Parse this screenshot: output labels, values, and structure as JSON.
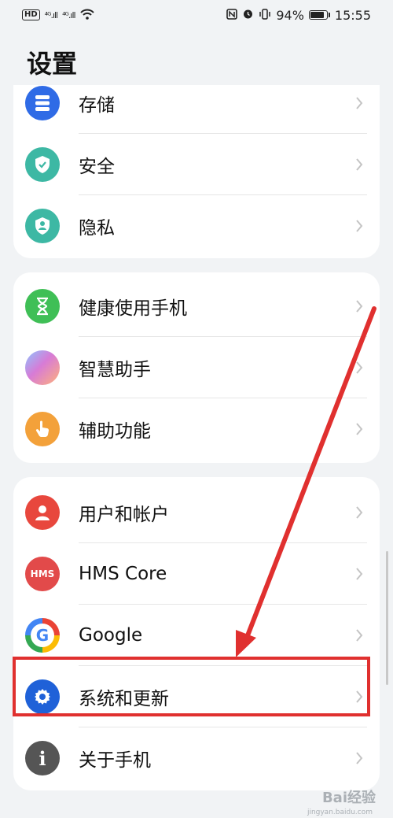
{
  "statusbar": {
    "hd": "HD",
    "net1": "⁴ᴳ.ıll",
    "net2": "⁴ᴳ.ıll",
    "battery_percent": "94%",
    "battery_level": 0.94,
    "time": "15:55"
  },
  "page_title": "设置",
  "groups": [
    {
      "items": [
        {
          "label": "存储",
          "icon": "storage-icon",
          "color": "#2f6be6"
        },
        {
          "label": "安全",
          "icon": "security-shield-icon",
          "color": "#3db8a4"
        },
        {
          "label": "隐私",
          "icon": "privacy-icon",
          "color": "#3db8a4"
        }
      ]
    },
    {
      "items": [
        {
          "label": "健康使用手机",
          "icon": "hourglass-icon",
          "color": "#3fbf56"
        },
        {
          "label": "智慧助手",
          "icon": "assistant-orb-icon",
          "color": "#d77bd6"
        },
        {
          "label": "辅助功能",
          "icon": "hand-pointer-icon",
          "color": "#f3a13a"
        }
      ]
    },
    {
      "items": [
        {
          "label": "用户和帐户",
          "icon": "user-icon",
          "color": "#e8473d"
        },
        {
          "label": "HMS Core",
          "icon": "hms-icon",
          "color": "#e24a4a",
          "icon_text": "HMS"
        },
        {
          "label": "Google",
          "icon": "google-icon",
          "color": "#4285f4",
          "icon_text": "G"
        },
        {
          "label": "系统和更新",
          "icon": "gear-icon",
          "color": "#1f61d8"
        },
        {
          "label": "关于手机",
          "icon": "info-icon",
          "color": "#555555",
          "icon_text": "i"
        }
      ]
    }
  ],
  "annotation": {
    "color": "#e0302f"
  },
  "watermark": {
    "main": "Bai经验",
    "sub": "jingyan.baidu.com"
  }
}
